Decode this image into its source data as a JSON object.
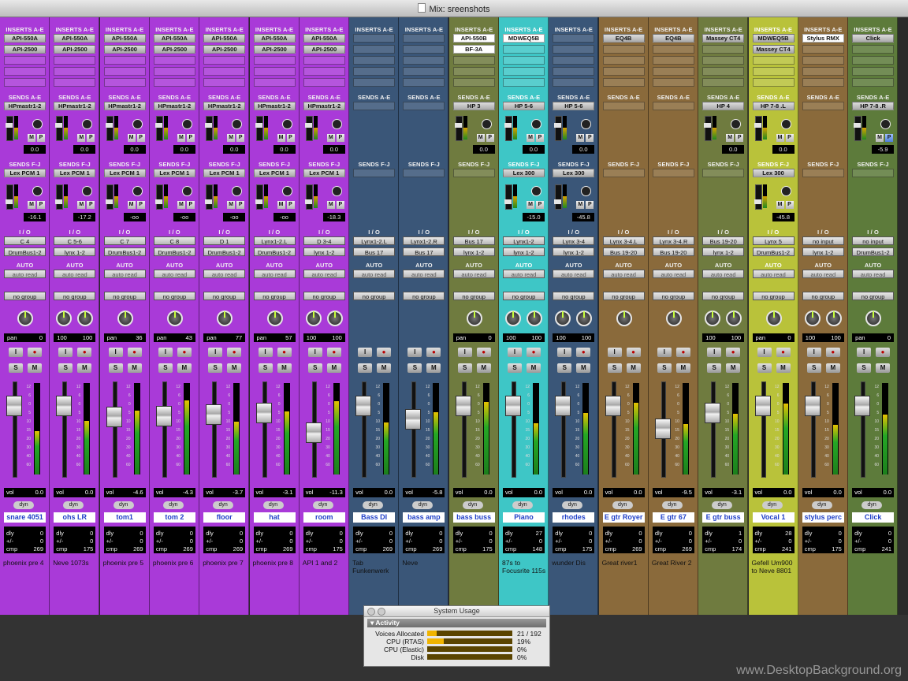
{
  "window": {
    "title": "Mix: sreenshots"
  },
  "sections": {
    "inserts_ae": "INSERTS A-E",
    "sends_ae": "SENDS A-E",
    "sends_fj": "SENDS F-J",
    "io": "I / O",
    "auto": "AUTO"
  },
  "tracks": [
    {
      "name": "snare 4051",
      "color": "#a93ad8",
      "inserts": [
        "API-550A",
        "API-2500"
      ],
      "send_ae": "HPmastr1-2",
      "send_ae_val": "0.0",
      "send_fj": "Lex PCM 1",
      "send_fj_val": "-16.1",
      "in": "C 4",
      "out": "DrumBus1-2",
      "auto": "auto read",
      "group": "no group",
      "pan": "pan",
      "pan_val": "0",
      "knobs": 1,
      "vol": "0.0",
      "dly": "0",
      "pm": "0",
      "cmp": "269",
      "comment": "phoenix pre 4"
    },
    {
      "name": "ohs LR",
      "color": "#a93ad8",
      "inserts": [
        "API-550A",
        "API-2500"
      ],
      "send_ae": "HPmastr1-2",
      "send_ae_val": "0.0",
      "send_fj": "Lex PCM 1",
      "send_fj_val": "-17.2",
      "in": "C 5-6",
      "out": "lynx 1-2",
      "auto": "auto read",
      "group": "no group",
      "pan": "100",
      "pan_val": "100",
      "knobs": 2,
      "vol": "0.0",
      "dly": "0",
      "pm": "0",
      "cmp": "175",
      "comment": "Neve 1073s"
    },
    {
      "name": "tom1",
      "color": "#a93ad8",
      "inserts": [
        "API-550A",
        "API-2500"
      ],
      "send_ae": "HPmastr1-2",
      "send_ae_val": "0.0",
      "send_fj": "Lex PCM 1",
      "send_fj_val": "-oo",
      "in": "C 7",
      "out": "DrumBus1-2",
      "auto": "auto read",
      "group": "no group",
      "pan": "pan",
      "pan_val": "36",
      "knobs": 1,
      "vol": "-4.6",
      "dly": "0",
      "pm": "0",
      "cmp": "269",
      "comment": "phoenix pre 5"
    },
    {
      "name": "tom 2",
      "color": "#a93ad8",
      "inserts": [
        "API-550A",
        "API-2500"
      ],
      "send_ae": "HPmastr1-2",
      "send_ae_val": "0.0",
      "send_fj": "Lex PCM 1",
      "send_fj_val": "-oo",
      "in": "C 8",
      "out": "DrumBus1-2",
      "auto": "auto read",
      "group": "no group",
      "pan": "pan",
      "pan_val": "43",
      "knobs": 1,
      "vol": "-4.3",
      "dly": "0",
      "pm": "0",
      "cmp": "269",
      "comment": "phoenix pre 6"
    },
    {
      "name": "floor",
      "color": "#a93ad8",
      "inserts": [
        "API-550A",
        "API-2500"
      ],
      "send_ae": "HPmastr1-2",
      "send_ae_val": "0.0",
      "send_fj": "Lex PCM 1",
      "send_fj_val": "-oo",
      "in": "D 1",
      "out": "DrumBus1-2",
      "auto": "auto read",
      "group": "no group",
      "pan": "pan",
      "pan_val": "77",
      "knobs": 1,
      "vol": "-3.7",
      "dly": "0",
      "pm": "0",
      "cmp": "269",
      "comment": "phoenix pre 7"
    },
    {
      "name": "hat",
      "color": "#a93ad8",
      "inserts": [
        "API-550A",
        "API-2500"
      ],
      "send_ae": "HPmastr1-2",
      "send_ae_val": "0.0",
      "send_fj": "Lex PCM 1",
      "send_fj_val": "-oo",
      "in": "Lynx1-2.L",
      "out": "DrumBus1-2",
      "auto": "auto read",
      "group": "no group",
      "pan": "pan",
      "pan_val": "57",
      "knobs": 1,
      "vol": "-3.1",
      "dly": "0",
      "pm": "0",
      "cmp": "269",
      "comment": "phoenix pre 8"
    },
    {
      "name": "room",
      "color": "#a93ad8",
      "inserts": [
        "API-550A",
        "API-2500"
      ],
      "send_ae": "HPmastr1-2",
      "send_ae_val": "0.0",
      "send_fj": "Lex PCM 1",
      "send_fj_val": "-18.3",
      "in": "D 3-4",
      "out": "lynx 1-2",
      "auto": "auto read",
      "group": "no group",
      "pan": "100",
      "pan_val": "100",
      "knobs": 2,
      "vol": "-11.3",
      "dly": "0",
      "pm": "0",
      "cmp": "175",
      "comment": "API 1 and 2"
    },
    {
      "name": "Bass DI",
      "color": "#3a5678",
      "inserts": [],
      "send_ae": "",
      "send_ae_val": "",
      "send_fj": "",
      "send_fj_val": "",
      "in": "Lynx1-2.L",
      "out": "Bus 17",
      "auto": "auto read",
      "group": "no group",
      "pan": "",
      "pan_val": "",
      "knobs": 0,
      "vol": "0.0",
      "dly": "0",
      "pm": "0",
      "cmp": "269",
      "comment": "Tab Funkenwerk"
    },
    {
      "name": "bass amp",
      "color": "#3a5678",
      "inserts": [],
      "send_ae": "",
      "send_ae_val": "",
      "send_fj": "",
      "send_fj_val": "",
      "in": "Lynx1-2.R",
      "out": "Bus 17",
      "auto": "auto read",
      "group": "no group",
      "pan": "",
      "pan_val": "",
      "knobs": 0,
      "vol": "-5.8",
      "dly": "0",
      "pm": "0",
      "cmp": "269",
      "comment": "Neve"
    },
    {
      "name": "bass buss",
      "color": "#6f7b3f",
      "inserts": [
        "API-550B",
        "BF-3A"
      ],
      "send_ae": "HP 3",
      "send_ae_val": "0.0",
      "send_fj": "",
      "send_fj_val": "",
      "in": "Bus 17",
      "out": "lynx 1-2",
      "auto": "auto read",
      "group": "no group",
      "pan": "pan",
      "pan_val": "0",
      "knobs": 1,
      "vol": "0.0",
      "dly": "0",
      "pm": "0",
      "cmp": "175",
      "comment": ""
    },
    {
      "name": "Piano",
      "color": "#3ec6c6",
      "inserts": [
        "MDWEQ5B"
      ],
      "send_ae": "HP 5-6",
      "send_ae_val": "0.0",
      "send_fj": "Lex 300",
      "send_fj_val": "-15.0",
      "in": "Lynx1-2",
      "out": "lynx 1-2",
      "auto": "auto read",
      "group": "no group",
      "pan": "100",
      "pan_val": "100",
      "knobs": 2,
      "vol": "0.0",
      "dly": "27",
      "pm": "0",
      "cmp": "148",
      "comment": "87s to Focusrite 115s"
    },
    {
      "name": "rhodes",
      "color": "#3a5678",
      "inserts": [],
      "send_ae": "HP 5-6",
      "send_ae_val": "0.0",
      "send_fj": "Lex 300",
      "send_fj_val": "-45.8",
      "in": "Lynx 3-4",
      "out": "lynx 1-2",
      "auto": "auto read",
      "group": "no group",
      "pan": "100",
      "pan_val": "100",
      "knobs": 2,
      "vol": "0.0",
      "dly": "0",
      "pm": "0",
      "cmp": "175",
      "comment": "wunder Dis"
    },
    {
      "name": "E gtr Royer",
      "color": "#8a6a3b",
      "inserts": [
        "EQ4B"
      ],
      "send_ae": "",
      "send_ae_val": "",
      "send_fj": "",
      "send_fj_val": "",
      "in": "Lynx 3-4.L",
      "out": "Bus 19-20",
      "auto": "auto read",
      "group": "no group",
      "pan": "",
      "pan_val": "",
      "knobs": 1,
      "vol": "0.0",
      "dly": "0",
      "pm": "0",
      "cmp": "269",
      "comment": "Great river1"
    },
    {
      "name": "E gtr 67",
      "color": "#8a6a3b",
      "inserts": [
        "EQ4B"
      ],
      "send_ae": "",
      "send_ae_val": "",
      "send_fj": "",
      "send_fj_val": "",
      "in": "Lynx 3-4.R",
      "out": "Bus 19-20",
      "auto": "auto read",
      "group": "no group",
      "pan": "",
      "pan_val": "",
      "knobs": 1,
      "vol": "-9.5",
      "dly": "0",
      "pm": "0",
      "cmp": "269",
      "comment": "Great River 2"
    },
    {
      "name": "E gtr buss",
      "color": "#6f7b3f",
      "inserts": [
        "Massey CT4"
      ],
      "send_ae": "HP 4",
      "send_ae_val": "0.0",
      "send_fj": "",
      "send_fj_val": "",
      "in": "Bus 19-20",
      "out": "lynx 1-2",
      "auto": "auto read",
      "group": "no group",
      "pan": "100",
      "pan_val": "100",
      "knobs": 2,
      "vol": "-3.1",
      "dly": "1",
      "pm": "0",
      "cmp": "174",
      "comment": ""
    },
    {
      "name": "Vocal 1",
      "color": "#b9c23a",
      "inserts": [
        "MDWEQ5B",
        "Massey CT4"
      ],
      "send_ae": "HP 7-8 .L",
      "send_ae_val": "0.0",
      "send_fj": "Lex 300",
      "send_fj_val": "-45.8",
      "in": "Lynx 5",
      "out": "DrumBus1-2",
      "auto": "auto read",
      "group": "no group",
      "pan": "pan",
      "pan_val": "0",
      "knobs": 1,
      "vol": "0.0",
      "dly": "28",
      "pm": "0",
      "cmp": "241",
      "comment": "Gefell Um900 to Neve 8801"
    },
    {
      "name": "stylus perc",
      "color": "#8a6a3b",
      "inserts": [
        "Stylus RMX"
      ],
      "send_ae": "",
      "send_ae_val": "",
      "send_fj": "",
      "send_fj_val": "",
      "in": "no input",
      "out": "lynx 1-2",
      "auto": "auto read",
      "group": "no group",
      "pan": "100",
      "pan_val": "100",
      "knobs": 2,
      "vol": "0.0",
      "dly": "0",
      "pm": "0",
      "cmp": "175",
      "comment": ""
    },
    {
      "name": "Click",
      "color": "#5d7b3b",
      "inserts": [
        "Click"
      ],
      "send_ae": "HP 7-8 .R",
      "send_ae_val": "-5.9",
      "send_fj": "",
      "send_fj_val": "",
      "in": "no input",
      "out": "DrumBus1-2",
      "auto": "auto read",
      "group": "no group",
      "pan": "pan",
      "pan_val": "0",
      "knobs": 1,
      "vol": "0.0",
      "dly": "0",
      "pm": "0",
      "cmp": "241",
      "comment": ""
    }
  ],
  "labels": {
    "mute": "M",
    "solo": "S",
    "input": "I",
    "rec": "●",
    "dyn": "dyn",
    "vol": "vol",
    "dly": "dly",
    "pm": "+/-",
    "cmp": "cmp",
    "plugin_m": "M",
    "plugin_p": "P"
  },
  "system_usage": {
    "title": "System Usage",
    "section": "Activity",
    "rows": [
      {
        "label": "Voices Allocated",
        "fill": 0.11,
        "value": "21 / 192"
      },
      {
        "label": "CPU (RTAS)",
        "fill": 0.19,
        "value": "19%"
      },
      {
        "label": "CPU (Elastic)",
        "fill": 0,
        "value": "0%"
      },
      {
        "label": "Disk",
        "fill": 0,
        "value": "0%"
      }
    ]
  },
  "watermark": "www.DesktopBackground.org"
}
